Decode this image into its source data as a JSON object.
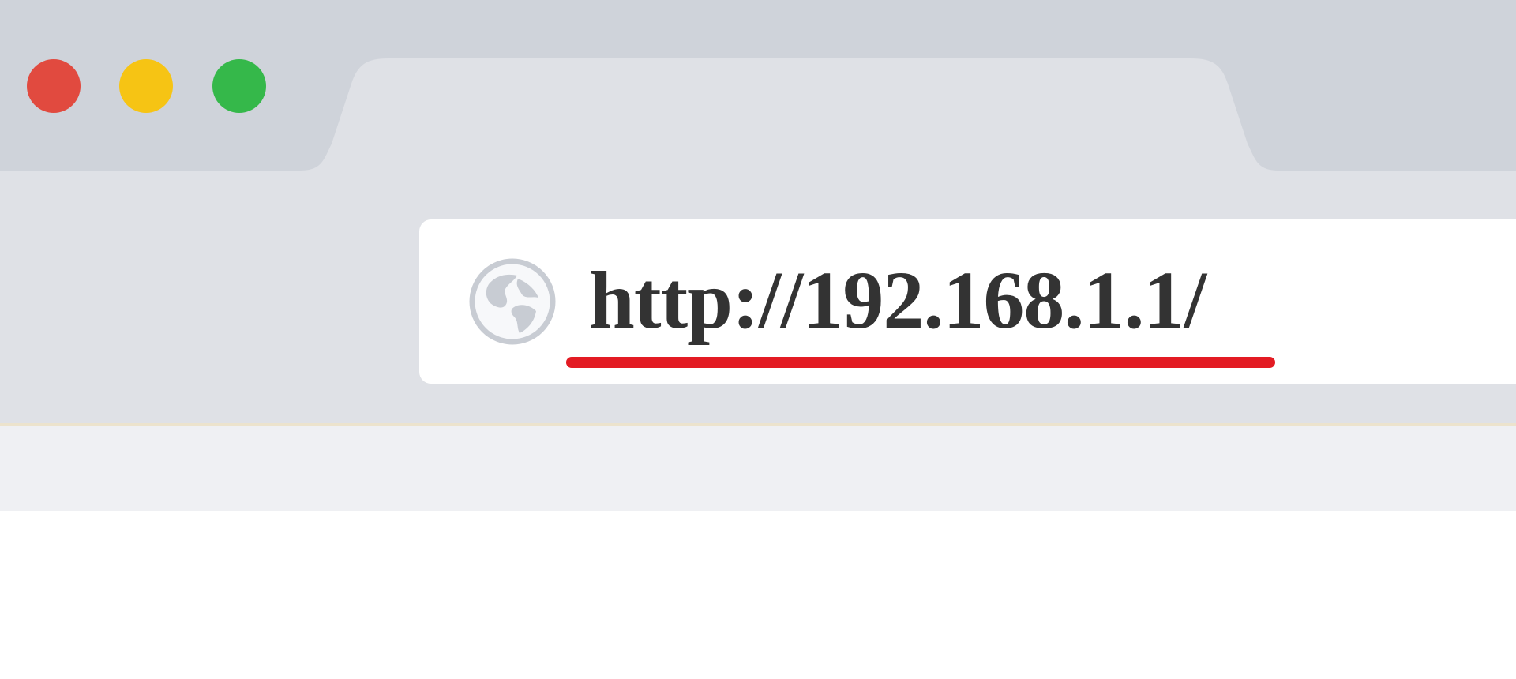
{
  "window": {
    "controls": {
      "close_color": "#e14a3f",
      "minimize_color": "#f6c414",
      "maximize_color": "#35b84a"
    }
  },
  "toolbar": {
    "back_icon": "arrow-left-icon",
    "forward_icon": "arrow-right-icon",
    "reload_icon": "reload-icon"
  },
  "address_bar": {
    "globe_icon": "globe-icon",
    "url": "http://192.168.1.1/",
    "highlight_color": "#e31b23"
  }
}
